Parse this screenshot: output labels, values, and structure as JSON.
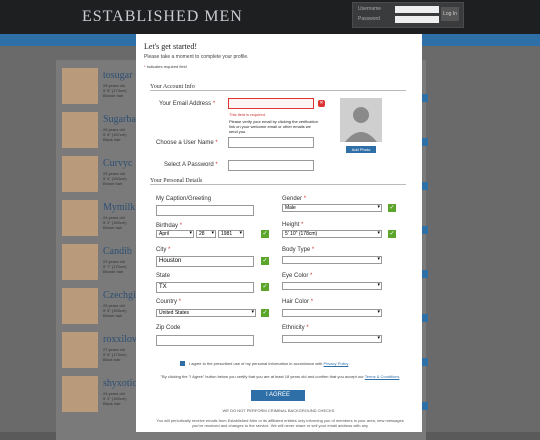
{
  "header": {
    "logo": "ESTABLISHED MEN",
    "login_username_label": "Username",
    "login_password_label": "Password",
    "login_button": "Log In"
  },
  "background_profiles": [
    {
      "name": "tosugar",
      "line1": "28 years old",
      "line2": "5' 8\" (173cm)",
      "line3": "Blonde hair"
    },
    {
      "name": "Sugarba",
      "line1": "26 years old",
      "line2": "5' 6\" (167cm)",
      "line3": "Black hair"
    },
    {
      "name": "Curvyc",
      "line1": "25 years old",
      "line2": "5' 4\" (163cm)",
      "line3": "Brown hair"
    },
    {
      "name": "Mymilk",
      "line1": "24 years old",
      "line2": "5' 2\" (160cm)",
      "line3": "Brown hair"
    },
    {
      "name": "Candib",
      "line1": "22 years old",
      "line2": "5' 7\" (170cm)",
      "line3": "Blonde hair"
    },
    {
      "name": "Czechgi",
      "line1": "25 years old",
      "line2": "5' 5\" (165cm)",
      "line3": "Brown hair"
    },
    {
      "name": "roxxilov",
      "line1": "27 years old",
      "line2": "5' 8\" (173cm)",
      "line3": "Black hair"
    },
    {
      "name": "shyxotic",
      "line1": "24 years old",
      "line2": "5' 3\" (160cm)",
      "line3": "Black hair"
    }
  ],
  "modal": {
    "title": "Let's get started!",
    "subtitle": "Please take a moment to complete your profile.",
    "required_note": "indicates required field",
    "account_section": "Your Account Info",
    "email_label": "Your Email Address",
    "email_value": "",
    "email_error": "This field is required.",
    "email_hint": "Please verify your email by clicking the verification link on your welcome email or other emails we send you.",
    "username_label": "Choose a User Name",
    "password_label": "Select A Password",
    "add_photo": "Add Photo",
    "personal_section": "Your Personal Details",
    "caption_label": "My Caption/Greeting",
    "gender_label": "Gender",
    "gender_value": "Male",
    "birthday_label": "Birthday",
    "birthday_month": "April",
    "birthday_day": "28",
    "birthday_year": "1981",
    "height_label": "Height",
    "height_value": "5' 10\" (178cm)",
    "city_label": "City",
    "city_value": "Houston",
    "bodytype_label": "Body Type",
    "state_label": "State",
    "state_value": "TX",
    "eyecolor_label": "Eye Color",
    "country_label": "Country",
    "country_value": "United States",
    "haircolor_label": "Hair Color",
    "zip_label": "Zip Code",
    "ethnicity_label": "Ethnicity",
    "terms_text": "I agree to the prescribed use of my personal information in accordance with",
    "privacy_link": "Privacy Policy",
    "certify_text": "\"By clicking the \"I Agree\" button below you certify that you are at least 18 years old and confirm that you accept our",
    "terms_link": "Terms & Conditions",
    "agree_button": "I AGREE",
    "no_background_check": "WE DO NOT PERFORM CRIMINAL BACKGROUND CHECKS.",
    "footer_text": "You will periodically receive emails from Established Men or its affiliated entities only informing you of members in your area, new messages you've received and changes to the service. We will never share or sell your email address with any"
  },
  "colors": {
    "accent": "#2f6fa8",
    "error": "#dd3333",
    "success": "#5aa52a"
  }
}
